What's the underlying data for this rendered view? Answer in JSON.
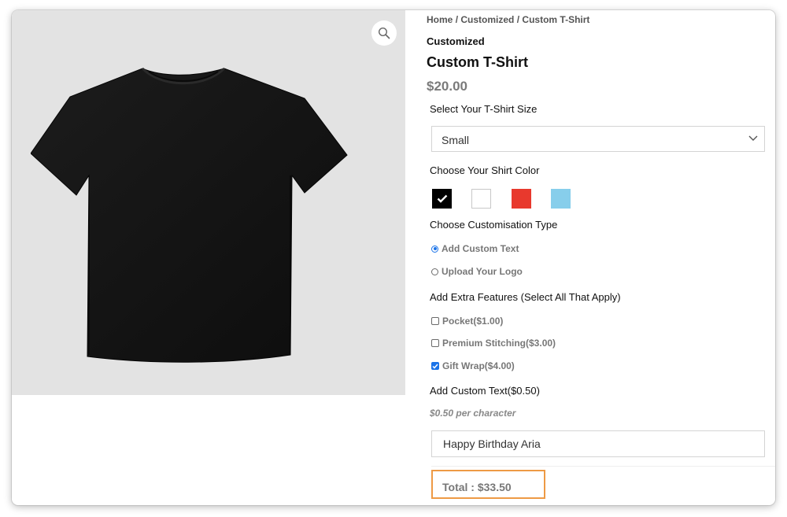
{
  "gallery": {
    "zoom_icon": "magnifier-icon",
    "product_image": "black-tshirt-image",
    "background_color": "#e3e3e3"
  },
  "breadcrumb": {
    "items": [
      "Home",
      "Customized",
      "Custom T-Shirt"
    ],
    "separator": "/"
  },
  "product": {
    "category": "Customized",
    "title": "Custom T-Shirt",
    "price": "$20.00"
  },
  "size": {
    "label": "Select Your T-Shirt Size",
    "selected": "Small",
    "chevron_icon": "chevron-down-icon"
  },
  "color": {
    "label": "Choose Your Shirt Color",
    "swatches": [
      {
        "name": "black",
        "hex": "#000000",
        "selected": true
      },
      {
        "name": "white",
        "hex": "#ffffff",
        "selected": false
      },
      {
        "name": "red",
        "hex": "#e8392d",
        "selected": false
      },
      {
        "name": "light-blue",
        "hex": "#87ceeb",
        "selected": false
      }
    ]
  },
  "customisation": {
    "label": "Choose Customisation Type",
    "options": [
      {
        "label": "Add Custom Text",
        "selected": true
      },
      {
        "label": "Upload Your Logo",
        "selected": false
      }
    ]
  },
  "extras": {
    "label": "Add Extra Features (Select All That Apply)",
    "options": [
      {
        "label": "Pocket($1.00)",
        "checked": false
      },
      {
        "label": "Premium Stitching($3.00)",
        "checked": false
      },
      {
        "label": "Gift Wrap($4.00)",
        "checked": true
      }
    ]
  },
  "custom_text": {
    "label": "Add Custom Text($0.50)",
    "hint": "$0.50 per character",
    "value": "Happy Birthday Aria"
  },
  "total": {
    "text": "Total : $33.50",
    "border_color": "#ee9a45"
  },
  "colors": {
    "accent": "#1a73e8",
    "price": "#7a7a7a",
    "text": "#111111"
  }
}
